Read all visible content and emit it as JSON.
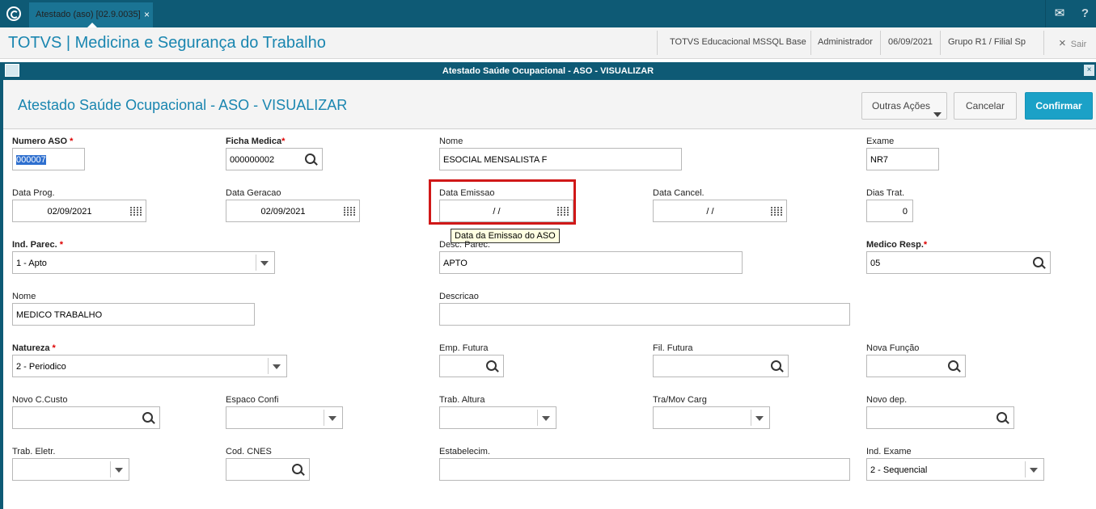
{
  "topbar": {
    "tab_label": "Atestado (aso) [02.9.0035]",
    "tab_close": "×"
  },
  "header": {
    "app_title": "TOTVS | Medicina e Segurança do Trabalho",
    "environment": "TOTVS Educacional MSSQL Base",
    "user": "Administrador",
    "date": "06/09/2021",
    "branch": "Grupo R1 / Filial Sp",
    "exit_label": "Sair",
    "exit_icon": "×"
  },
  "dialog": {
    "window_title": "Atestado Saúde Ocupacional - ASO - VISUALIZAR",
    "page_title": "Atestado Saúde Ocupacional - ASO - VISUALIZAR",
    "close": "×",
    "buttons": {
      "other_actions": "Outras Ações",
      "cancel": "Cancelar",
      "confirm": "Confirmar"
    }
  },
  "fields": {
    "numero_aso": {
      "label": "Numero ASO",
      "required": "*",
      "value": "000007"
    },
    "ficha_medica": {
      "label": "Ficha Medica",
      "required": "*",
      "value": "000000002"
    },
    "nome": {
      "label": "Nome",
      "value": "ESOCIAL MENSALISTA F"
    },
    "exame": {
      "label": "Exame",
      "value": "NR7"
    },
    "data_prog": {
      "label": "Data Prog.",
      "value": "02/09/2021"
    },
    "data_geracao": {
      "label": "Data Geracao",
      "value": "02/09/2021"
    },
    "data_emissao": {
      "label": "Data Emissao",
      "value": "/ /",
      "tooltip": "Data da Emissao do ASO"
    },
    "data_cancel": {
      "label": "Data Cancel.",
      "value": "/ /"
    },
    "dias_trat": {
      "label": "Dias Trat.",
      "value": "0"
    },
    "ind_parec": {
      "label": "Ind. Parec.",
      "required": "*",
      "value": "1 - Apto"
    },
    "desc_parec": {
      "label": "Desc. Parec.",
      "value": "APTO"
    },
    "medico_resp": {
      "label": "Medico Resp.",
      "required": "*",
      "value": "05"
    },
    "nome_medico": {
      "label": "Nome",
      "value": "MEDICO TRABALHO"
    },
    "descricao": {
      "label": "Descricao",
      "value": ""
    },
    "natureza": {
      "label": "Natureza",
      "required": "*",
      "value": "2 - Periodico"
    },
    "emp_futura": {
      "label": "Emp. Futura",
      "value": ""
    },
    "fil_futura": {
      "label": "Fil. Futura",
      "value": ""
    },
    "nova_funcao": {
      "label": "Nova Função",
      "value": ""
    },
    "novo_ccusto": {
      "label": "Novo C.Custo",
      "value": ""
    },
    "espaco_confi": {
      "label": "Espaco Confi",
      "value": ""
    },
    "trab_altura": {
      "label": "Trab. Altura",
      "value": ""
    },
    "tra_mov_carg": {
      "label": "Tra/Mov Carg",
      "value": ""
    },
    "novo_dep": {
      "label": "Novo dep.",
      "value": ""
    },
    "trab_eletr": {
      "label": "Trab. Eletr.",
      "value": ""
    },
    "cod_cnes": {
      "label": "Cod. CNES",
      "value": ""
    },
    "estabelecim": {
      "label": "Estabelecim.",
      "value": ""
    },
    "ind_exame": {
      "label": "Ind. Exame",
      "value": "2 - Sequencial"
    }
  },
  "colors": {
    "brand": "#0e5a75",
    "accent": "#1a86b0",
    "confirm": "#1ba1c7",
    "required": "#dd0000",
    "highlight": "#d01818"
  }
}
